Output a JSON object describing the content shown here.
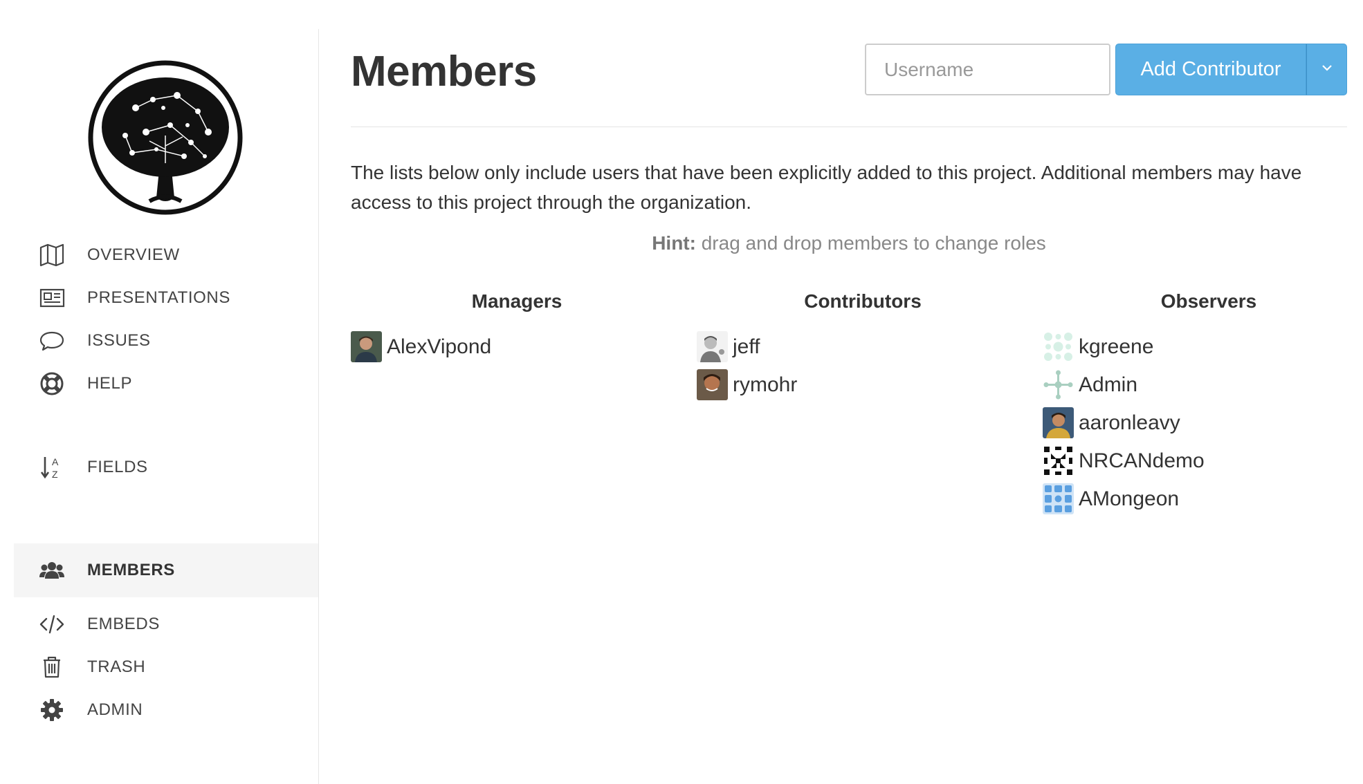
{
  "sidebar": {
    "items": [
      {
        "label": "OVERVIEW",
        "icon": "map-icon"
      },
      {
        "label": "PRESENTATIONS",
        "icon": "newspaper-icon"
      },
      {
        "label": "ISSUES",
        "icon": "speech-bubble-icon"
      },
      {
        "label": "HELP",
        "icon": "life-ring-icon"
      },
      {
        "label": "FIELDS",
        "icon": "sort-alpha-icon"
      },
      {
        "label": "MEMBERS",
        "icon": "users-icon",
        "active": true
      },
      {
        "label": "EMBEDS",
        "icon": "code-icon"
      },
      {
        "label": "TRASH",
        "icon": "trash-icon"
      },
      {
        "label": "ADMIN",
        "icon": "gear-icon"
      }
    ]
  },
  "header": {
    "title": "Members",
    "username_placeholder": "Username",
    "add_button_label": "Add Contributor"
  },
  "content": {
    "description": "The lists below only include users that have been explicitly added to this project. Additional members may have access to this project through the organization.",
    "hint_label": "Hint:",
    "hint_text": " drag and drop members to change roles"
  },
  "columns": {
    "managers": {
      "title": "Managers",
      "members": [
        "AlexVipond"
      ]
    },
    "contributors": {
      "title": "Contributors",
      "members": [
        "jeff",
        "rymohr"
      ]
    },
    "observers": {
      "title": "Observers",
      "members": [
        "kgreene",
        "Admin",
        "aaronleavy",
        "NRCANdemo",
        "AMongeon"
      ]
    }
  },
  "colors": {
    "accent": "#5aafe5",
    "active_bg": "#f5f5f5"
  }
}
